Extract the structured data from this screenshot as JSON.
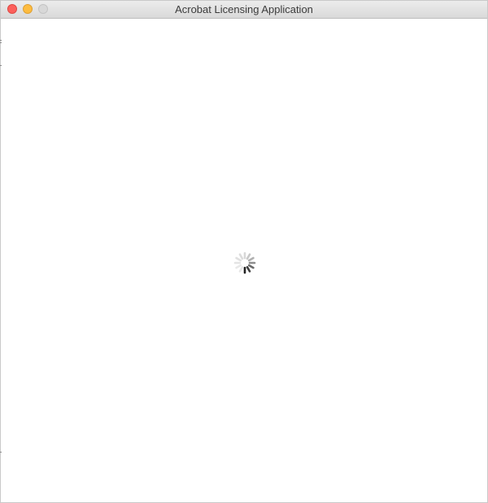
{
  "window": {
    "title": "Acrobat Licensing Application",
    "controls": {
      "close_color": "#fc605c",
      "minimize_color": "#fdbc40",
      "zoom_color": "#d8d8d8"
    }
  },
  "content": {
    "loading_indicator": "spinner"
  }
}
